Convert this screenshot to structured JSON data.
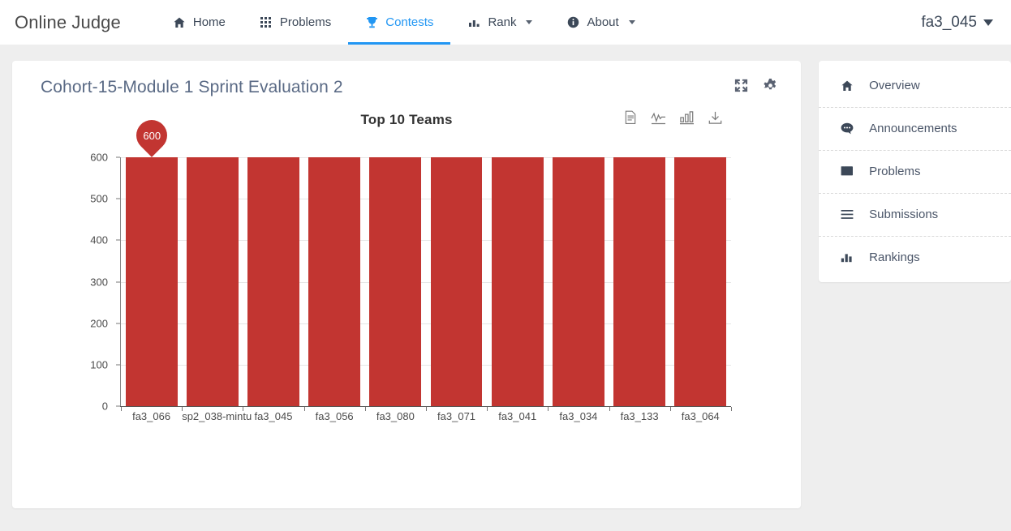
{
  "navbar": {
    "brand": "Online Judge",
    "items": [
      {
        "label": "Home",
        "icon": "home-icon",
        "active": false,
        "caret": false
      },
      {
        "label": "Problems",
        "icon": "grid-icon",
        "active": false,
        "caret": false
      },
      {
        "label": "Contests",
        "icon": "trophy-icon",
        "active": true,
        "caret": false
      },
      {
        "label": "Rank",
        "icon": "bar-chart-icon",
        "active": false,
        "caret": true
      },
      {
        "label": "About",
        "icon": "info-circle-icon",
        "active": false,
        "caret": true
      }
    ],
    "user": "fa3_045",
    "active_color": "#2196f3"
  },
  "card": {
    "title": "Cohort-15-Module 1 Sprint Evaluation 2",
    "tools": [
      {
        "name": "fullscreen-icon",
        "label": "Fullscreen"
      },
      {
        "name": "gear-icon",
        "label": "Settings"
      }
    ]
  },
  "chart_toolbox": [
    {
      "name": "data-view-icon",
      "label": "Data View"
    },
    {
      "name": "line-chart-icon",
      "label": "Switch to Line Chart"
    },
    {
      "name": "bar-chart-icon",
      "label": "Switch to Bar Chart"
    },
    {
      "name": "download-icon",
      "label": "Save as Image"
    }
  ],
  "chart_data": {
    "type": "bar",
    "title": "Top 10 Teams",
    "xlabel": "",
    "ylabel": "",
    "categories": [
      "fa3_066",
      "sp2_038-mintu",
      "fa3_045",
      "fa3_056",
      "fa3_080",
      "fa3_071",
      "fa3_041",
      "fa3_034",
      "fa3_133",
      "fa3_064"
    ],
    "values": [
      600,
      600,
      600,
      600,
      600,
      600,
      600,
      600,
      600,
      600
    ],
    "ylim": [
      0,
      600
    ],
    "yticks": [
      0,
      100,
      200,
      300,
      400,
      500,
      600
    ],
    "grid": true,
    "legend": false,
    "bar_color": "#c23531",
    "marker": {
      "label": "600",
      "category_index": 0,
      "value": 600
    }
  },
  "sidebar": {
    "items": [
      {
        "label": "Overview",
        "icon": "home-icon"
      },
      {
        "label": "Announcements",
        "icon": "chat-bubble-icon"
      },
      {
        "label": "Problems",
        "icon": "copy-pages-icon"
      },
      {
        "label": "Submissions",
        "icon": "list-lines-icon"
      },
      {
        "label": "Rankings",
        "icon": "bar-chart-icon"
      }
    ]
  }
}
